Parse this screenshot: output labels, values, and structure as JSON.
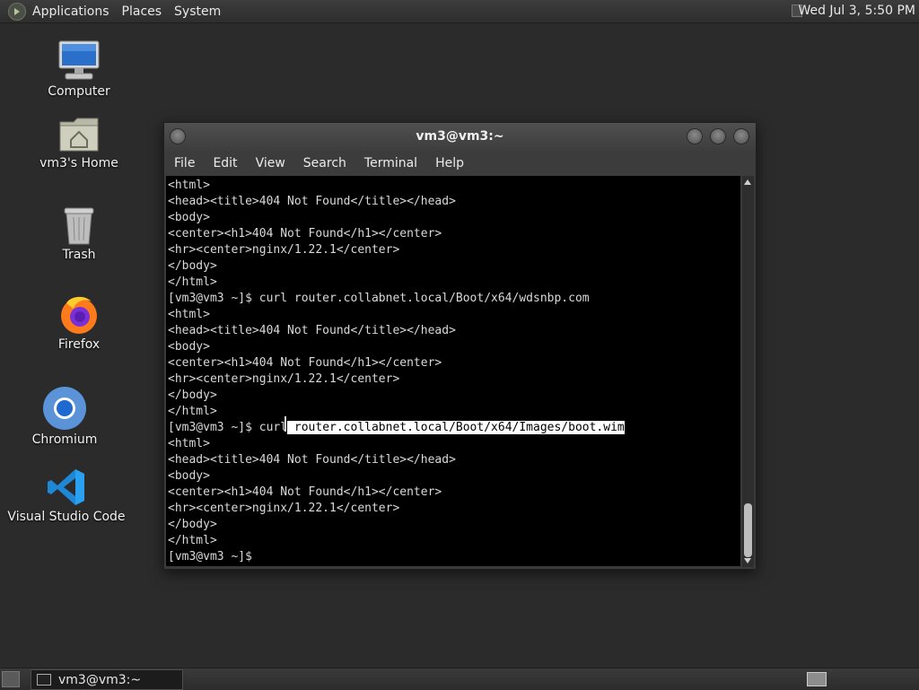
{
  "top_panel": {
    "menus": [
      "Applications",
      "Places",
      "System"
    ],
    "clock": "Wed Jul  3,  5:50 PM"
  },
  "desktop": {
    "icons": [
      {
        "label": "Computer",
        "icon": "computer-icon"
      },
      {
        "label": "vm3's Home",
        "icon": "home-folder-icon"
      },
      {
        "label": "Trash",
        "icon": "trash-icon"
      },
      {
        "label": "Firefox",
        "icon": "firefox-icon"
      },
      {
        "label": "Chromium",
        "icon": "chromium-icon"
      },
      {
        "label": "Visual Studio Code",
        "icon": "vscode-icon"
      }
    ]
  },
  "window": {
    "title": "vm3@vm3:~",
    "menu": [
      "File",
      "Edit",
      "View",
      "Search",
      "Terminal",
      "Help"
    ]
  },
  "terminal": {
    "lines": [
      "<html>",
      "<head><title>404 Not Found</title></head>",
      "<body>",
      "<center><h1>404 Not Found</h1></center>",
      "<hr><center>nginx/1.22.1</center>",
      "</body>",
      "</html>",
      "[vm3@vm3 ~]$ curl router.collabnet.local/Boot/x64/wdsnbp.com",
      "<html>",
      "<head><title>404 Not Found</title></head>",
      "<body>",
      "<center><h1>404 Not Found</h1></center>",
      "<hr><center>nginx/1.22.1</center>",
      "</body>",
      "</html>",
      "[vm3@vm3 ~]$ curl",
      "<html>",
      "<head><title>404 Not Found</title></head>",
      "<body>",
      "<center><h1>404 Not Found</h1></center>",
      "<hr><center>nginx/1.22.1</center>",
      "</body>",
      "</html>",
      "[vm3@vm3 ~]$"
    ],
    "selected_text": " router.collabnet.local/Boot/x64/Images/boot.wim"
  },
  "taskbar": {
    "task": "vm3@vm3:~"
  }
}
